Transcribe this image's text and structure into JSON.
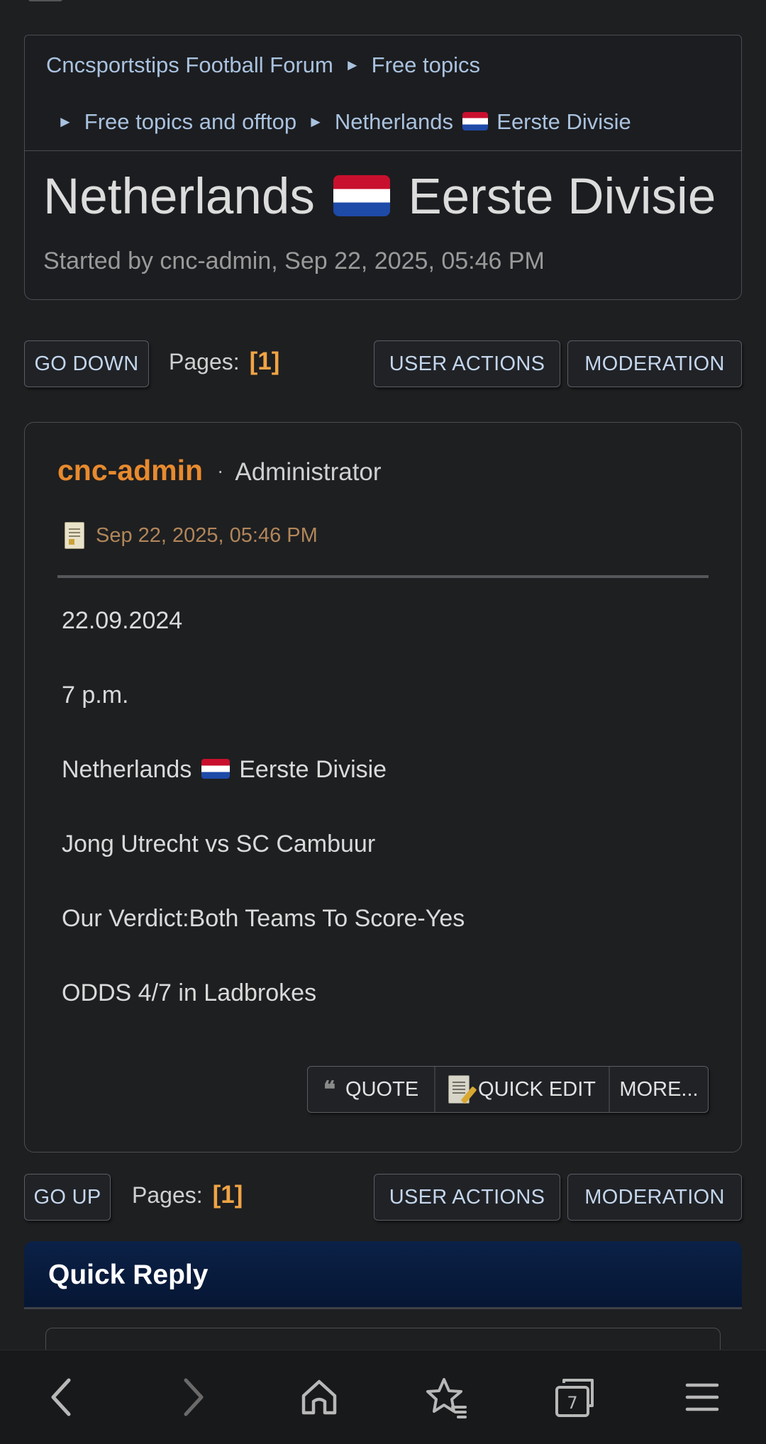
{
  "breadcrumb": {
    "items": [
      "Cncsportstips Football Forum",
      "Free topics",
      "Free topics and offtop",
      "Netherlands",
      "Eerste Divisie"
    ],
    "separator": "►"
  },
  "topic": {
    "title_prefix": "Netherlands",
    "title_suffix": "Eerste Divisie",
    "started_by": "Started by cnc-admin, Sep 22, 2025, 05:46 PM"
  },
  "top_bar": {
    "go_down": "GO DOWN",
    "pages_label": "Pages:",
    "pages_value": "[1]",
    "user_actions": "USER ACTIONS",
    "moderation": "MODERATION"
  },
  "post": {
    "author": "cnc-admin",
    "dot": "·",
    "role": "Administrator",
    "date": "Sep 22, 2025, 05:46 PM",
    "lines": {
      "date": "22.09.2024",
      "time": "7 p.m.",
      "league_prefix": "Netherlands",
      "league_suffix": "Eerste Divisie",
      "match": "Jong Utrecht vs SC Cambuur",
      "verdict": "Our Verdict:Both Teams To Score-Yes",
      "odds": "ODDS 4/7 in Ladbrokes"
    },
    "actions": {
      "quote": "QUOTE",
      "quote_icon": "❝",
      "quick_edit": "QUICK EDIT",
      "more": "MORE..."
    }
  },
  "bottom_bar": {
    "go_up": "GO UP",
    "pages_label": "Pages:",
    "pages_value": "[1]",
    "user_actions": "USER ACTIONS",
    "moderation": "MODERATION"
  },
  "quick_reply": {
    "title": "Quick Reply"
  },
  "browser": {
    "tab_count": "7",
    "icons": [
      "back-icon",
      "forward-icon",
      "home-icon",
      "bookmarks-icon",
      "tabs-icon",
      "menu-icon"
    ]
  },
  "colors": {
    "background": "#1e1f21",
    "link": "#a9c2df",
    "author": "#e88a2e",
    "pages_number": "#f0a445",
    "quick_reply_header": "#0b2147"
  }
}
